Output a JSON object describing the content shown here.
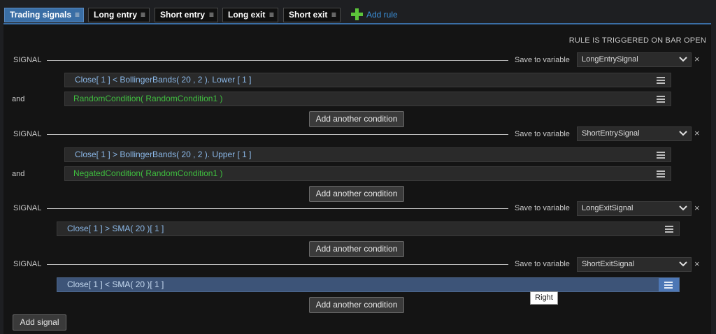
{
  "tabs": [
    {
      "label": "Trading signals",
      "active": true
    },
    {
      "label": "Long entry",
      "active": false
    },
    {
      "label": "Short entry",
      "active": false
    },
    {
      "label": "Long exit",
      "active": false
    },
    {
      "label": "Short exit",
      "active": false
    }
  ],
  "tab_menu_glyph": "≡",
  "add_rule_label": "Add rule",
  "trigger_note": "RULE IS TRIGGERED ON BAR OPEN",
  "signals": [
    {
      "label": "SIGNAL",
      "save_label": "Save to variable",
      "variable": "LongEntrySignal",
      "conditions": [
        {
          "connector": "",
          "text": "Close[ 1 ] < BollingerBands( 20 , 2 ). Lower [ 1 ]"
        },
        {
          "connector": "and",
          "text": "RandomCondition( RandomCondition1 )"
        }
      ],
      "add_condition_label": "Add another condition"
    },
    {
      "label": "SIGNAL",
      "save_label": "Save to variable",
      "variable": "ShortEntrySignal",
      "conditions": [
        {
          "connector": "",
          "text": "Close[ 1 ] > BollingerBands( 20 , 2 ). Upper [ 1 ]"
        },
        {
          "connector": "and",
          "text": "NegatedCondition( RandomCondition1 )"
        }
      ],
      "add_condition_label": "Add another condition"
    },
    {
      "label": "SIGNAL",
      "save_label": "Save to variable",
      "variable": "LongExitSignal",
      "conditions": [
        {
          "connector": "",
          "text": "Close[ 1 ] > SMA( 20 )[ 1 ]"
        }
      ],
      "add_condition_label": "Add another condition"
    },
    {
      "label": "SIGNAL",
      "save_label": "Save to variable",
      "variable": "ShortExitSignal",
      "conditions": [
        {
          "connector": "",
          "text": "Close[ 1 ] < SMA( 20 )[ 1 ]"
        }
      ],
      "add_condition_label": "Add another condition"
    }
  ],
  "remove_glyph": "×",
  "tooltip": "Right",
  "add_signal_label": "Add signal",
  "colors": {
    "accent": "#3a6ea5",
    "condition_blue": "#8bb8e8",
    "condition_green": "#3fbf3f",
    "selected_row": "#3d5478",
    "add_icon": "#5cc43a"
  }
}
